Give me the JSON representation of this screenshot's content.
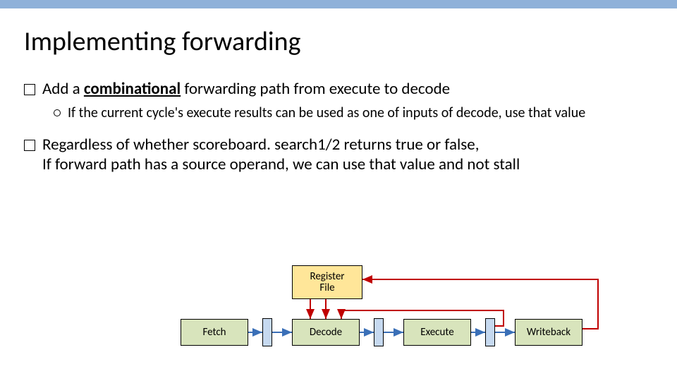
{
  "title": "Implementing forwarding",
  "bullet1_pre": "Add a ",
  "bullet1_underlined": "combinational",
  "bullet1_post": " forwarding path from execute to decode",
  "sub1": "If the current cycle's execute results can be used as one of inputs of decode, use that value",
  "bullet2_line1": "Regardless of whether scoreboard. search1/2 returns true or false,",
  "bullet2_line2": "If forward path has a source operand, we can use that value and not stall",
  "regfile_l1": "Register",
  "regfile_l2": "File",
  "stages": {
    "fetch": "Fetch",
    "decode": "Decode",
    "execute": "Execute",
    "writeback": "Writeback"
  }
}
